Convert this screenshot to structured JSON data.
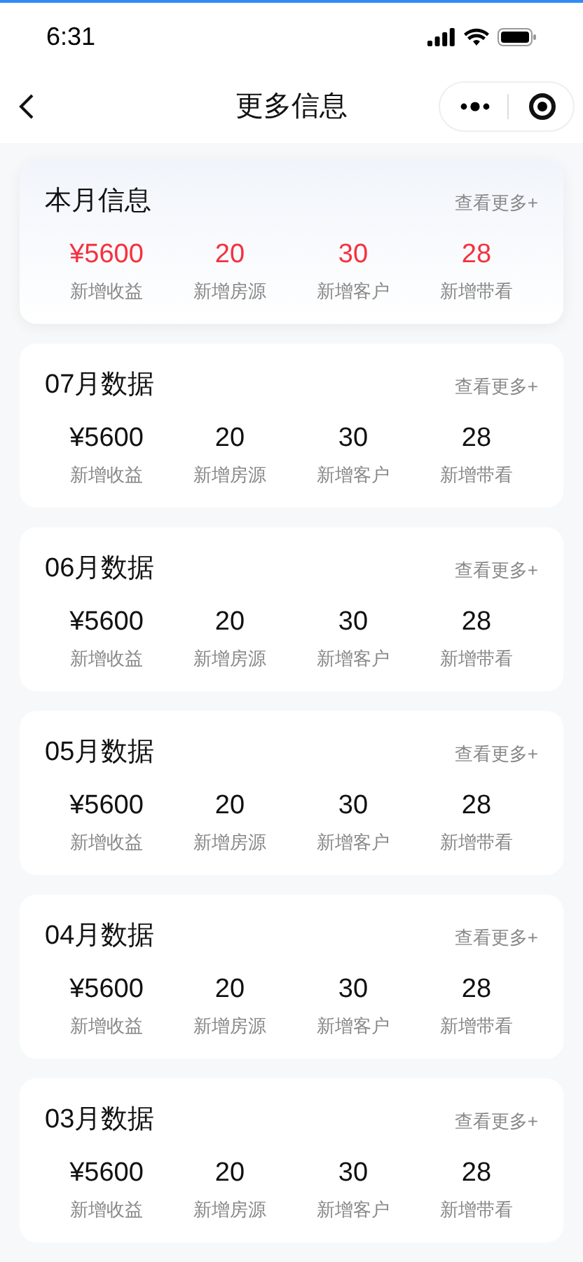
{
  "status_bar": {
    "time": "6:31"
  },
  "nav": {
    "title": "更多信息"
  },
  "cards": [
    {
      "title": "本月信息",
      "more": "查看更多+",
      "highlighted": true,
      "stats": [
        {
          "value": "¥5600",
          "label": "新增收益"
        },
        {
          "value": "20",
          "label": "新增房源"
        },
        {
          "value": "30",
          "label": "新增客户"
        },
        {
          "value": "28",
          "label": "新增带看"
        }
      ]
    },
    {
      "title": "07月数据",
      "more": "查看更多+",
      "highlighted": false,
      "stats": [
        {
          "value": "¥5600",
          "label": "新增收益"
        },
        {
          "value": "20",
          "label": "新增房源"
        },
        {
          "value": "30",
          "label": "新增客户"
        },
        {
          "value": "28",
          "label": "新增带看"
        }
      ]
    },
    {
      "title": "06月数据",
      "more": "查看更多+",
      "highlighted": false,
      "stats": [
        {
          "value": "¥5600",
          "label": "新增收益"
        },
        {
          "value": "20",
          "label": "新增房源"
        },
        {
          "value": "30",
          "label": "新增客户"
        },
        {
          "value": "28",
          "label": "新增带看"
        }
      ]
    },
    {
      "title": "05月数据",
      "more": "查看更多+",
      "highlighted": false,
      "stats": [
        {
          "value": "¥5600",
          "label": "新增收益"
        },
        {
          "value": "20",
          "label": "新增房源"
        },
        {
          "value": "30",
          "label": "新增客户"
        },
        {
          "value": "28",
          "label": "新增带看"
        }
      ]
    },
    {
      "title": "04月数据",
      "more": "查看更多+",
      "highlighted": false,
      "stats": [
        {
          "value": "¥5600",
          "label": "新增收益"
        },
        {
          "value": "20",
          "label": "新增房源"
        },
        {
          "value": "30",
          "label": "新增客户"
        },
        {
          "value": "28",
          "label": "新增带看"
        }
      ]
    },
    {
      "title": "03月数据",
      "more": "查看更多+",
      "highlighted": false,
      "stats": [
        {
          "value": "¥5600",
          "label": "新增收益"
        },
        {
          "value": "20",
          "label": "新增房源"
        },
        {
          "value": "30",
          "label": "新增客户"
        },
        {
          "value": "28",
          "label": "新增带看"
        }
      ]
    }
  ]
}
